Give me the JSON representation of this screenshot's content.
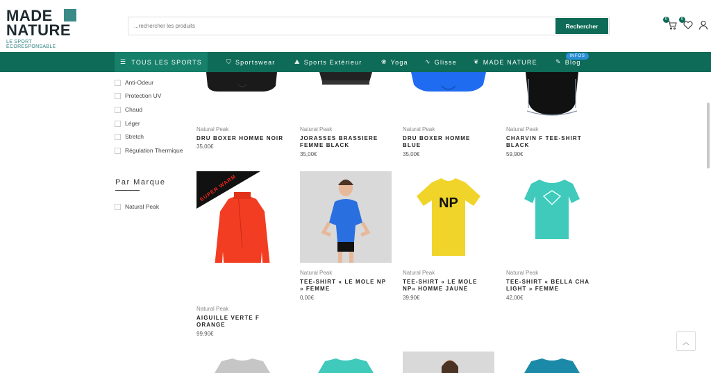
{
  "header": {
    "logo_line1": "MADE",
    "logo_line2": "NATURE",
    "logo_tagline": "LE SPORT ÉCORESPONSABLE",
    "search_placeholder": "...rechercher les produits",
    "search_button": "Rechercher",
    "cart_count": "0",
    "wishlist_count": "0",
    "icons": [
      "cart-icon",
      "heart-icon",
      "user-icon"
    ]
  },
  "nav": {
    "all_sports": "TOUS LES SPORTS",
    "items": [
      {
        "label": "Sportswear",
        "icon": "tshirt-icon"
      },
      {
        "label": "Sports Extérieur",
        "icon": "mountain-icon"
      },
      {
        "label": "Yoga",
        "icon": "lotus-icon"
      },
      {
        "label": "Glisse",
        "icon": "wave-icon"
      },
      {
        "label": "MADE NATURE",
        "icon": "leaf-icon"
      },
      {
        "label": "Blog",
        "icon": "pen-icon"
      }
    ],
    "infos_badge": "INFOS"
  },
  "sidebar": {
    "filters": [
      "Anti-Odeur",
      "Protection UV",
      "Chaud",
      "Léger",
      "Stretch",
      "Régulation Thermique"
    ],
    "brand_title": "Par Marque",
    "brands": [
      "Natural Peak"
    ]
  },
  "products": [
    {
      "brand": "Natural Peak",
      "name": "DRU BOXER HOMME NOIR",
      "price": "35,00€"
    },
    {
      "brand": "Natural Peak",
      "name": "JORASSES BRASSIERE FEMME BLACK",
      "price": "35,00€"
    },
    {
      "brand": "Natural Peak",
      "name": "DRU BOXER HOMME BLUE",
      "price": "35,00€"
    },
    {
      "brand": "Natural Peak",
      "name": "CHARVIN F TEE-SHIRT BLACK",
      "price": "59,90€"
    },
    {
      "brand": "Natural Peak",
      "name": "AIGUILLE VERTE F ORANGE",
      "price": "99,90€",
      "ribbon": "SUPER WARM"
    },
    {
      "brand": "Natural Peak",
      "name": "TEE-SHIRT « LE MOLE NP » FEMME",
      "price": "0,00€"
    },
    {
      "brand": "Natural Peak",
      "name": "TEE-SHIRT « LE MOLE NP» HOMME JAUNE",
      "price": "39,90€"
    },
    {
      "brand": "Natural Peak",
      "name": "TEE-SHIRT « BELLA CHA LIGHT » FEMME",
      "price": "42,00€"
    }
  ],
  "colors": {
    "brand_green": "#0e6b57",
    "accent_teal": "#3a8a88",
    "infos_blue": "#2b8fd6"
  }
}
